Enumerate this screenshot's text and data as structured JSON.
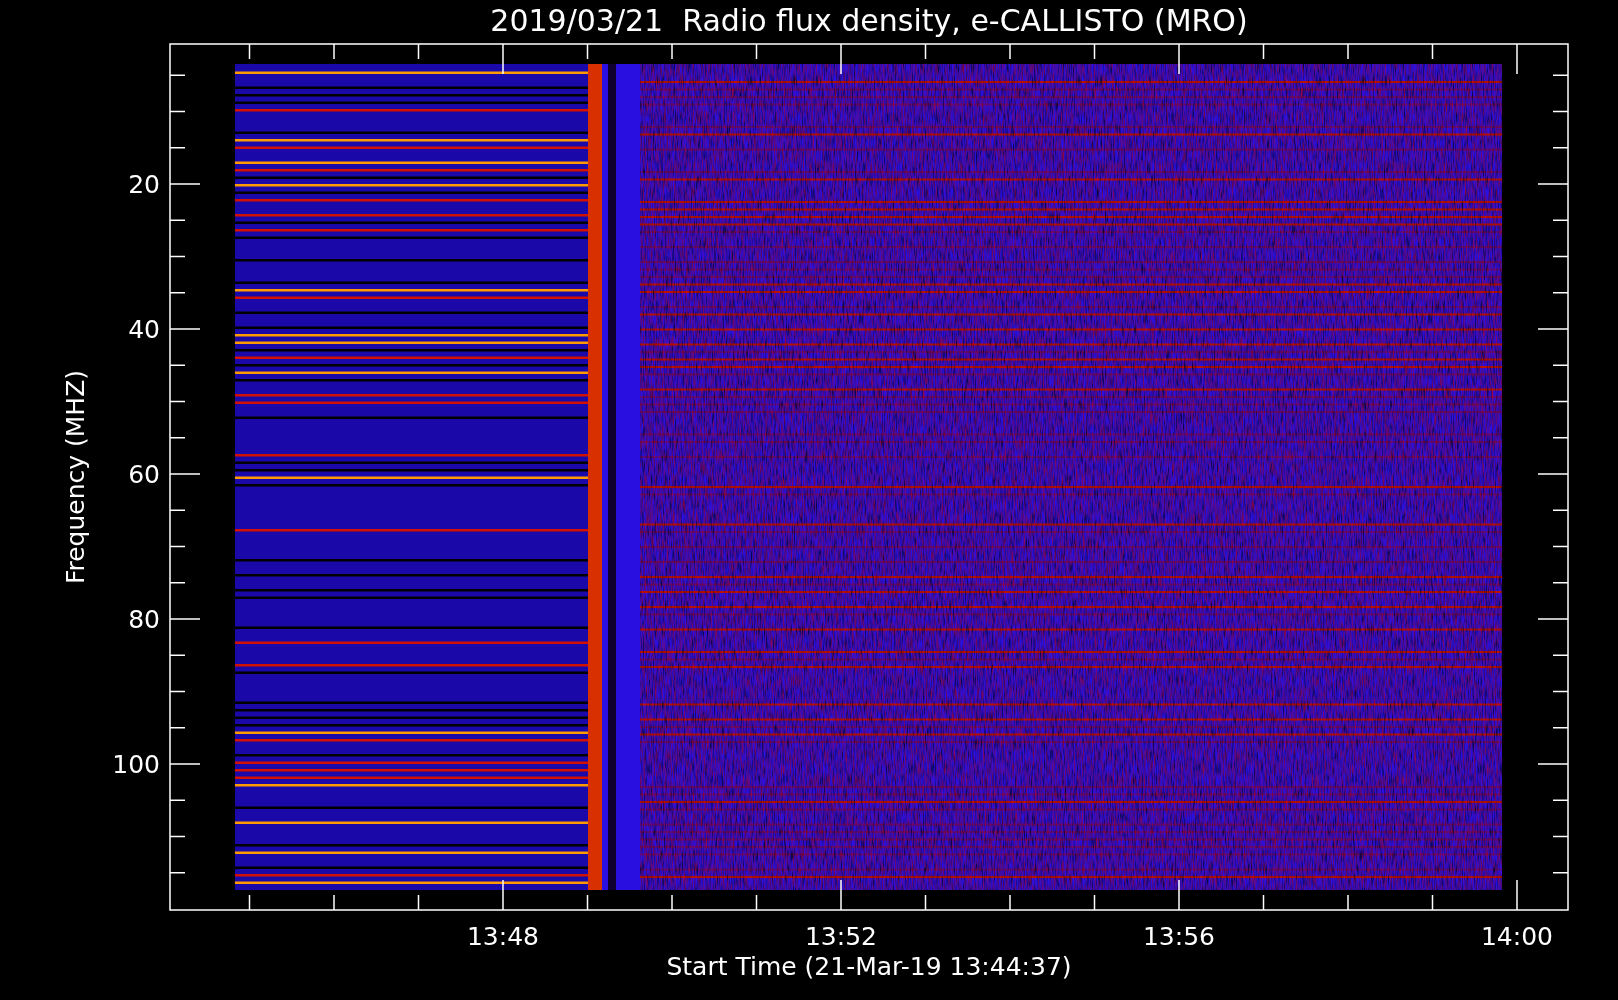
{
  "plot": {
    "title": "2019/03/21  Radio flux density, e-CALLISTO (MRO)",
    "ylabel": "Frequency (MHZ)",
    "yticks": [
      "20",
      "40",
      "60",
      "80",
      "100"
    ],
    "xlabel": "Start Time (21-Mar-19 13:44:37)",
    "xticks": [
      "13:48",
      "13:52",
      "13:56",
      "14:00"
    ]
  }
}
